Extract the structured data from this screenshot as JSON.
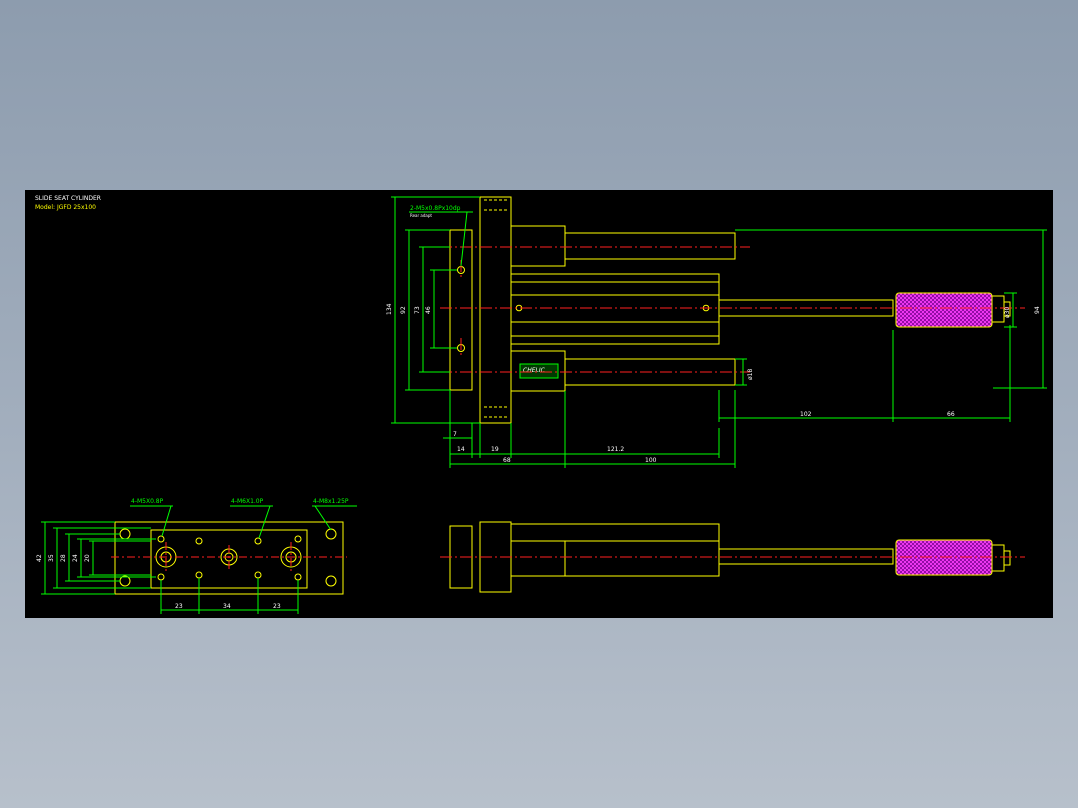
{
  "title": {
    "line1": "SLIDE SEAT CYLINDER",
    "line2": "Model: JGFD 25x100"
  },
  "callouts": {
    "top_thread": "2-M5x0.8Px10dp",
    "top_thread_sub": "Rear adapt",
    "bottom_m5": "4-M5X0.8P",
    "bottom_m6": "4-M6X1.0P",
    "bottom_m8": "4-M8x1.25P"
  },
  "brand": "CHELIC",
  "dims_top": {
    "v134": "134",
    "v92": "92",
    "v73": "73",
    "v46": "46",
    "v94": "94",
    "v30": "ø30",
    "v18": "ø18",
    "h7": "7",
    "h14": "14",
    "h19": "19",
    "h68": "68",
    "h121": "121.2",
    "h100": "100",
    "h102": "102",
    "h66": "66"
  },
  "dims_bottom": {
    "v42": "42",
    "v35": "35",
    "v28": "28",
    "v24": "24",
    "v20": "20",
    "h23a": "23",
    "h34": "34",
    "h23b": "23"
  },
  "colors": {
    "outline": "#ffff00",
    "dimension": "#00ff00",
    "centerline": "#ff2020",
    "text": "#ffffff",
    "grip": "#ff00ff"
  }
}
